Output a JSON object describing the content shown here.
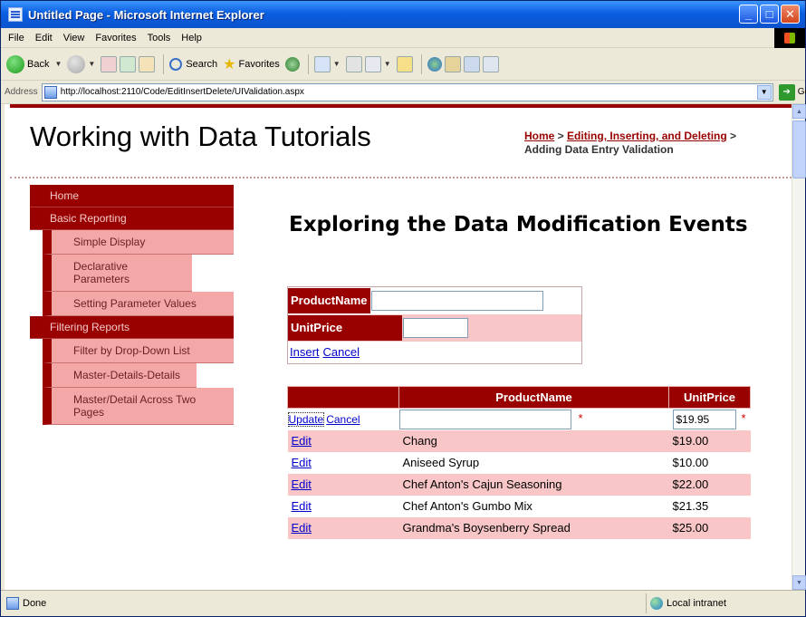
{
  "window": {
    "title": "Untitled Page - Microsoft Internet Explorer"
  },
  "menu": [
    "File",
    "Edit",
    "View",
    "Favorites",
    "Tools",
    "Help"
  ],
  "toolbar": {
    "back_label": "Back",
    "search_label": "Search",
    "favorites_label": "Favorites"
  },
  "address": {
    "label": "Address",
    "url": "http://localhost:2110/Code/EditInsertDelete/UIValidation.aspx",
    "go_label": "Go"
  },
  "site": {
    "title": "Working with Data Tutorials"
  },
  "breadcrumb": {
    "home": "Home",
    "sep1": " > ",
    "section": "Editing, Inserting, and Deleting",
    "sep2": " > ",
    "current": "Adding Data Entry Validation"
  },
  "nav": {
    "home": "Home",
    "basic_reporting": "Basic Reporting",
    "basic_items": [
      "Simple Display",
      "Declarative Parameters",
      "Setting Parameter Values"
    ],
    "filtering_reports": "Filtering Reports",
    "filtering_items": [
      "Filter by Drop-Down List",
      "Master-Details-Details",
      "Master/Detail Across Two Pages"
    ]
  },
  "main": {
    "heading": "Exploring the Data Modification Events"
  },
  "insert_form": {
    "product_label": "ProductName",
    "price_label": "UnitPrice",
    "insert_link": "Insert",
    "cancel_link": "Cancel"
  },
  "grid": {
    "headers": [
      "",
      "ProductName",
      "UnitPrice"
    ],
    "edit_row": {
      "update_link": "Update",
      "cancel_link": "Cancel",
      "price_value": "$19.95",
      "required_marker": "*"
    },
    "edit_link": "Edit",
    "rows": [
      {
        "name": "Chang",
        "price": "$19.00"
      },
      {
        "name": "Aniseed Syrup",
        "price": "$10.00"
      },
      {
        "name": "Chef Anton's Cajun Seasoning",
        "price": "$22.00"
      },
      {
        "name": "Chef Anton's Gumbo Mix",
        "price": "$21.35"
      },
      {
        "name": "Grandma's Boysenberry Spread",
        "price": "$25.00"
      }
    ]
  },
  "status": {
    "text": "Done",
    "zone": "Local intranet"
  }
}
